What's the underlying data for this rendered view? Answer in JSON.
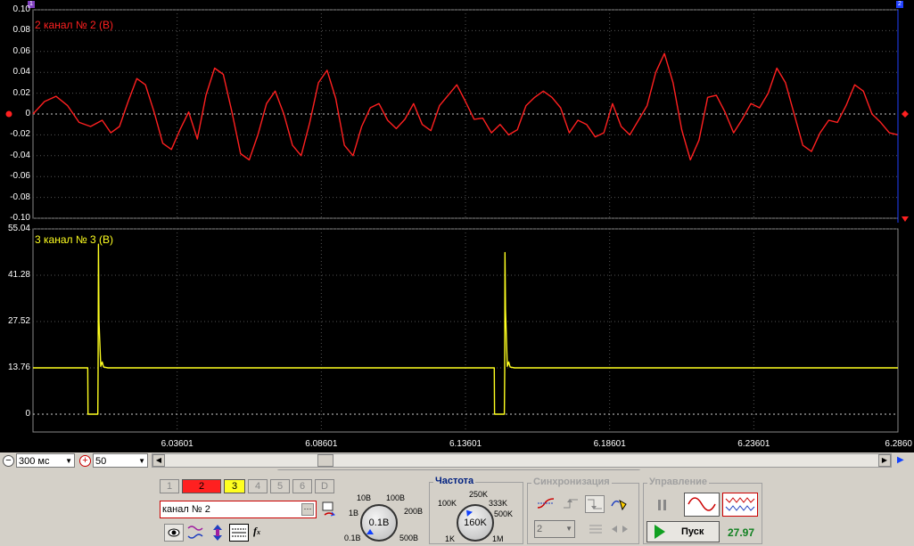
{
  "colors": {
    "ch2": "#ff2020",
    "ch3": "#ffff20",
    "grid": "#666666",
    "background": "#000000"
  },
  "top_panel": {
    "label": "2  канал № 2 (В)",
    "y_ticks": [
      "0.10",
      "0.08",
      "0.06",
      "0.04",
      "0.02",
      "0",
      "-0.02",
      "-0.04",
      "-0.06",
      "-0.08",
      "-0.10"
    ]
  },
  "bottom_panel": {
    "label": "3  канал № 3 (В)",
    "y_ticks": [
      "55.04",
      "41.28",
      "27.52",
      "13.76",
      "0"
    ]
  },
  "x_ticks": [
    "6.03601",
    "6.08601",
    "6.13601",
    "6.18601",
    "6.23601",
    "6.2860"
  ],
  "markers": {
    "left": "1",
    "right": "2"
  },
  "toolbar": {
    "timebase": "300 мс",
    "scale": "50"
  },
  "channel_buttons": [
    "1",
    "2",
    "3",
    "4",
    "5",
    "6",
    "D"
  ],
  "channel_name": "канал № 2",
  "voltage_knob": {
    "value": "0.1В",
    "labels": [
      "10В",
      "100В",
      "1В",
      "200В",
      "0.1В",
      "500В"
    ]
  },
  "frequency": {
    "title": "Частота",
    "value": "160K",
    "labels": [
      "250K",
      "100K",
      "333K",
      "500K",
      "1K",
      "1M"
    ]
  },
  "sync": {
    "title": "Синхронизация",
    "channel": "2"
  },
  "control": {
    "title": "Управление",
    "start": "Пуск",
    "readout": "27.97"
  },
  "chart_data": [
    {
      "type": "line",
      "title": "2  канал № 2 (В)",
      "ylim": [
        -0.1,
        0.1
      ],
      "xlim": [
        5.98601,
        6.286
      ],
      "series": [
        {
          "name": "канал № 2",
          "color": "#ff2020",
          "x": [
            5.986,
            5.99,
            5.994,
            5.998,
            6.002,
            6.006,
            6.01,
            6.013,
            6.016,
            6.019,
            6.022,
            6.025,
            6.028,
            6.031,
            6.034,
            6.037,
            6.04,
            6.043,
            6.046,
            6.049,
            6.052,
            6.055,
            6.058,
            6.061,
            6.064,
            6.067,
            6.07,
            6.073,
            6.076,
            6.079,
            6.082,
            6.085,
            6.088,
            6.091,
            6.094,
            6.097,
            6.1,
            6.103,
            6.106,
            6.109,
            6.112,
            6.115,
            6.118,
            6.121,
            6.124,
            6.127,
            6.13,
            6.133,
            6.136,
            6.139,
            6.142,
            6.145,
            6.148,
            6.151,
            6.154,
            6.157,
            6.16,
            6.163,
            6.166,
            6.169,
            6.172,
            6.175,
            6.178,
            6.181,
            6.184,
            6.187,
            6.19,
            6.193,
            6.196,
            6.199,
            6.202,
            6.205,
            6.208,
            6.211,
            6.214,
            6.217,
            6.22,
            6.223,
            6.226,
            6.229,
            6.232,
            6.235,
            6.238,
            6.241,
            6.244,
            6.247,
            6.25,
            6.253,
            6.256,
            6.259,
            6.262,
            6.265,
            6.268,
            6.271,
            6.274,
            6.277,
            6.28,
            6.283,
            6.286
          ],
          "y": [
            0.0,
            0.012,
            0.017,
            0.008,
            -0.008,
            -0.012,
            -0.006,
            -0.018,
            -0.012,
            0.012,
            0.034,
            0.028,
            0.002,
            -0.028,
            -0.034,
            -0.015,
            0.002,
            -0.024,
            0.018,
            0.044,
            0.038,
            0.002,
            -0.038,
            -0.044,
            -0.02,
            0.01,
            0.022,
            0.0,
            -0.03,
            -0.04,
            -0.008,
            0.03,
            0.042,
            0.015,
            -0.03,
            -0.04,
            -0.012,
            0.006,
            0.01,
            -0.006,
            -0.014,
            -0.005,
            0.01,
            -0.01,
            -0.016,
            0.008,
            0.018,
            0.028,
            0.012,
            -0.005,
            -0.004,
            -0.018,
            -0.01,
            -0.02,
            -0.015,
            0.008,
            0.016,
            0.022,
            0.016,
            0.006,
            -0.018,
            -0.006,
            -0.01,
            -0.022,
            -0.018,
            0.01,
            -0.012,
            -0.02,
            -0.006,
            0.008,
            0.04,
            0.058,
            0.03,
            -0.015,
            -0.044,
            -0.025,
            0.016,
            0.018,
            0.002,
            -0.018,
            -0.005,
            0.01,
            0.006,
            0.02,
            0.044,
            0.03,
            0.0,
            -0.03,
            -0.036,
            -0.018,
            -0.006,
            -0.008,
            0.008,
            0.028,
            0.022,
            0.0,
            -0.008,
            -0.018,
            -0.02
          ]
        }
      ]
    },
    {
      "type": "line",
      "title": "3  канал № 3 (В)",
      "ylim": [
        0,
        55.04
      ],
      "xlim": [
        5.98601,
        6.286
      ],
      "series": [
        {
          "name": "канал № 3",
          "color": "#ffff20",
          "x": [
            5.986,
            6.005,
            6.0051,
            6.0085,
            6.0086,
            6.0087,
            6.0089,
            6.0095,
            6.01,
            6.0105,
            6.012,
            6.146,
            6.1461,
            6.1495,
            6.1496,
            6.1497,
            6.1499,
            6.1505,
            6.151,
            6.1515,
            6.153,
            6.286
          ],
          "y": [
            13.76,
            13.76,
            0,
            0,
            13.0,
            50.5,
            27.5,
            14.2,
            15.5,
            14.0,
            13.76,
            13.76,
            0,
            0,
            13.0,
            48.0,
            31.0,
            14.2,
            15.5,
            14.0,
            13.76,
            13.76
          ]
        }
      ]
    }
  ]
}
